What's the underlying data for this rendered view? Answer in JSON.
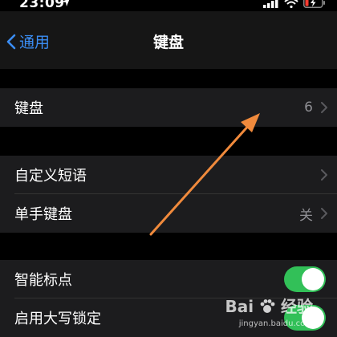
{
  "status_bar": {
    "time": "23:09"
  },
  "nav": {
    "back_label": "通用",
    "title": "键盘"
  },
  "group1": {
    "keyboards": {
      "label": "键盘",
      "value": "6"
    }
  },
  "group2": {
    "text_replacement": {
      "label": "自定义短语"
    },
    "one_handed": {
      "label": "单手键盘",
      "value": "关"
    }
  },
  "group3": {
    "smart_punctuation": {
      "label": "智能标点",
      "on": true
    },
    "caps_lock": {
      "label": "启用大写锁定",
      "on": true
    }
  },
  "watermark": {
    "brand": "Bai",
    "brand_suffix": "经验",
    "url": "jingyan.baidu.com"
  },
  "colors": {
    "accent": "#3b8ef5",
    "toggle_on": "#32c058",
    "arrow": "#f08a3c",
    "battery_low": "#ff3b30"
  },
  "icons": [
    "location-arrow-icon",
    "signal-icon",
    "wifi-icon",
    "battery-charging-icon",
    "chevron-left-icon",
    "chevron-right-icon",
    "paw-icon"
  ]
}
